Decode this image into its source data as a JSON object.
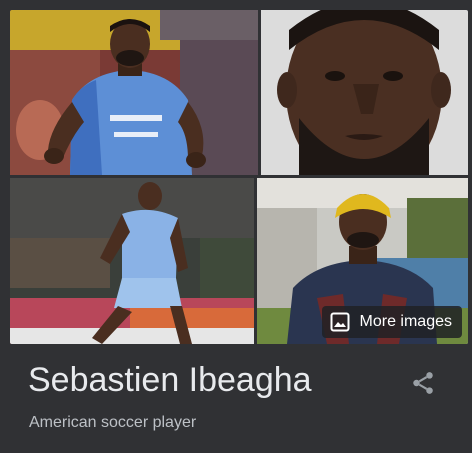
{
  "knowledge_panel": {
    "title": "Sebastien Ibeagha",
    "subtitle": "American soccer player",
    "more_images_label": "More images"
  },
  "icons": {
    "more_images": "image-icon",
    "share": "share-icon"
  },
  "colors": {
    "background": "#303134",
    "title": "#e8eaed",
    "subtitle": "#bdc1c6",
    "overlay": "#202124"
  }
}
